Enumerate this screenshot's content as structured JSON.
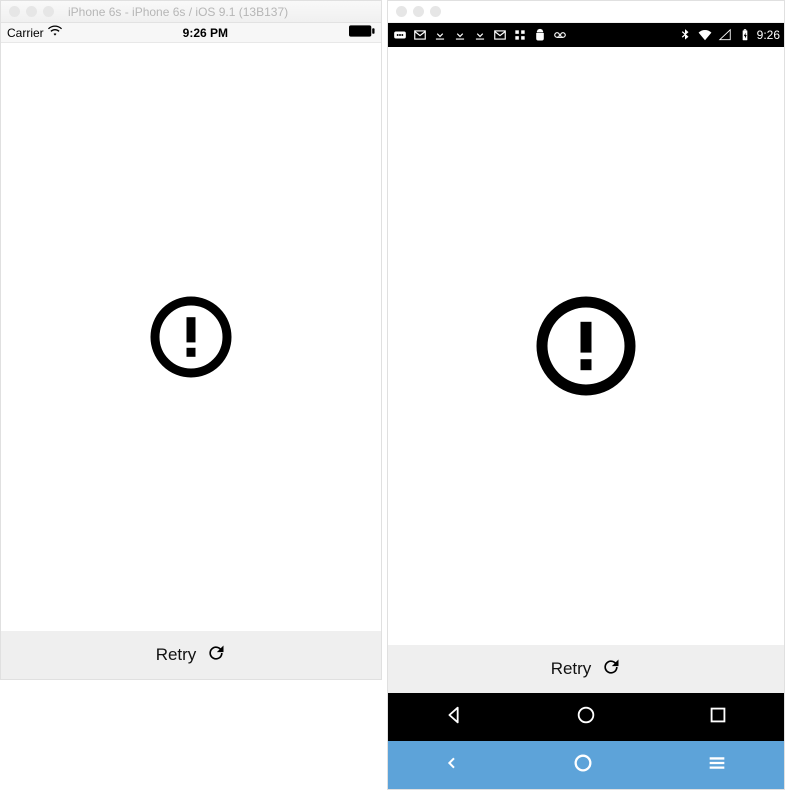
{
  "ios": {
    "window_title": "iPhone 6s - iPhone 6s / iOS 9.1 (13B137)",
    "statusbar": {
      "carrier": "Carrier",
      "time": "9:26 PM"
    },
    "retry_label": "Retry"
  },
  "android": {
    "statusbar": {
      "time": "9:26"
    },
    "retry_label": "Retry"
  }
}
